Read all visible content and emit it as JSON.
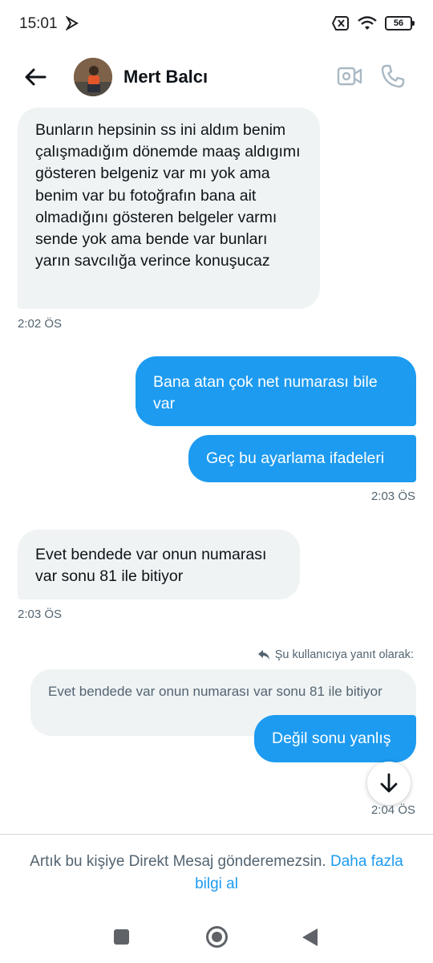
{
  "status_bar": {
    "time": "15:01",
    "battery": "56"
  },
  "header": {
    "name": "Mert Balcı"
  },
  "messages": [
    {
      "text": "Bunların hepsinin ss ini aldım benim çalışmadığım dönemde maaş aldıgımı gösteren belgeniz var mı yok ama benim var bu fotoğrafın bana ait olmadığını gösteren belgeler varmı sende yok ama bende var bunları yarın savcılığa verince konuşucaz",
      "time": "2:02 ÖS"
    },
    {
      "text": "Bana atan çok net  numarası bile var"
    },
    {
      "text": "Geç bu ayarlama ifadeleri",
      "time": "2:03 ÖS"
    },
    {
      "text": "Evet bendede var onun numarası var sonu 81 ile bitiyor",
      "time": "2:03 ÖS"
    },
    {
      "reply_label": "Şu kullanıcıya yanıt olarak:",
      "quoted": "Evet bendede var onun numarası var sonu 81 ile bitiyor",
      "text": "Değil sonu yanlış",
      "time": "2:04 ÖS"
    }
  ],
  "footer": {
    "text": "Artık bu kişiye Direkt Mesaj gönderemezsin. ",
    "link": "Daha fazla bilgi al"
  },
  "icons": [
    "back-arrow-icon",
    "video-call-icon",
    "phone-icon",
    "reply-arrow-icon",
    "scroll-down-icon"
  ],
  "colors": {
    "accent": "#1d9bf0",
    "incoming_bubble": "#eff3f4",
    "secondary_text": "#536471"
  }
}
